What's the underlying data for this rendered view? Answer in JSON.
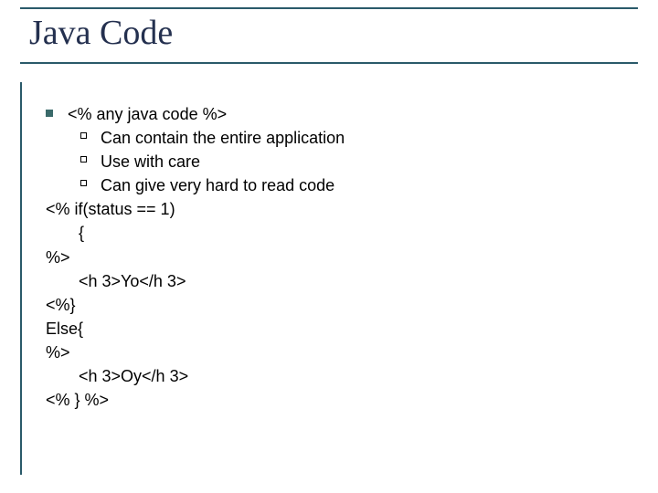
{
  "title": "Java Code",
  "bullet1": "<% any java code %>",
  "sub1": "Can contain the entire application",
  "sub2": "Use with care",
  "sub3": "Can give very hard to read code",
  "code": {
    "l1": "<% if(status == 1)",
    "l2": "{",
    "l3": "%>",
    "l4": "<h 3>Yo</h 3>",
    "l5": "<%}",
    "l6": "Else{",
    "l7": "%>",
    "l8": "<h 3>Oy</h 3>",
    "l9": "<% } %>"
  }
}
